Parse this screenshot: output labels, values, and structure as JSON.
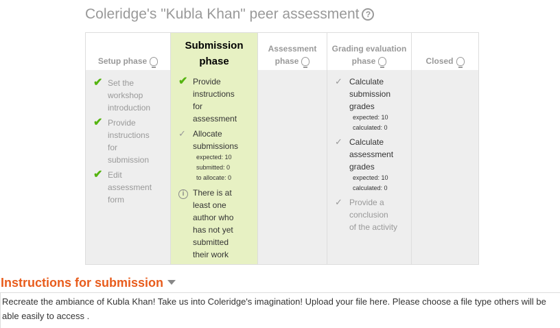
{
  "title": "Coleridge's \"Kubla Khan\" peer assessment",
  "help_icon": "question-circle-icon",
  "phases": [
    {
      "name": "Setup phase",
      "active": false,
      "tasks": [
        {
          "status": "done",
          "lines": [
            "Set the",
            "workshop",
            "introduction"
          ]
        },
        {
          "status": "done",
          "lines": [
            "Provide",
            "instructions",
            "for",
            "submission"
          ]
        },
        {
          "status": "done",
          "lines": [
            "Edit",
            "assessment",
            "form"
          ]
        }
      ]
    },
    {
      "name_line1": "Submission",
      "name_line2": "phase",
      "active": true,
      "tasks": [
        {
          "status": "done",
          "lines": [
            "Provide",
            "instructions",
            "for",
            "assessment"
          ]
        },
        {
          "status": "todo",
          "lines": [
            "Allocate",
            "submissions"
          ],
          "details": [
            "expected: 10",
            "submitted: 0",
            "to allocate: 0"
          ]
        },
        {
          "status": "info",
          "lines": [
            "There is at",
            "least one",
            "author who",
            "has not yet",
            "submitted",
            "their work"
          ]
        }
      ]
    },
    {
      "name_line1": "Assessment",
      "name_line2": "phase",
      "active": false,
      "tasks": []
    },
    {
      "name_line1": "Grading evaluation",
      "name_line2": "phase",
      "active": false,
      "tasks": [
        {
          "status": "todo",
          "lines": [
            "Calculate",
            "submission",
            "grades"
          ],
          "details": [
            "expected: 10",
            "calculated: 0"
          ]
        },
        {
          "status": "todo",
          "lines": [
            "Calculate",
            "assessment",
            "grades"
          ],
          "details": [
            "expected: 10",
            "calculated: 0"
          ]
        },
        {
          "status": "todo",
          "lines": [
            "Provide a",
            "conclusion",
            "of the activity"
          ]
        }
      ]
    },
    {
      "name": "Closed",
      "active": false,
      "tasks": []
    }
  ],
  "section": {
    "title": "Instructions for submission",
    "text": "Recreate the ambiance of Kubla Khan! Take us into Coleridge's imagination! Upload your file here.  Please choose a file type others will be able easily to access ."
  },
  "colors": {
    "active_phase_bg": "#e7f1c3",
    "done_check": "#55b410",
    "section_title": "#e85c1c"
  }
}
